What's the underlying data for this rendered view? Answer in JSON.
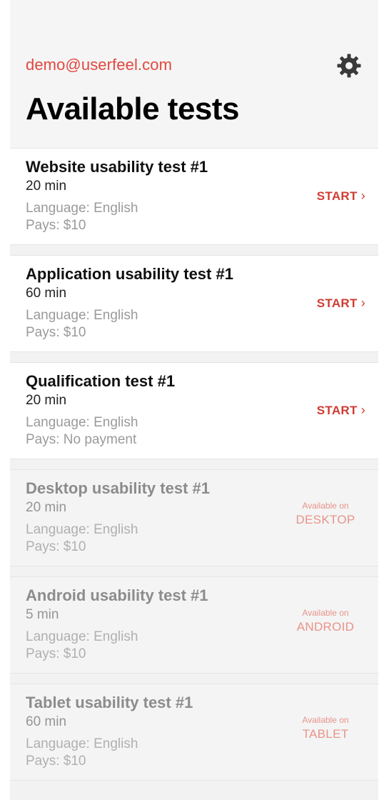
{
  "header": {
    "account_email": "demo@userfeel.com",
    "settings_icon": "gear-icon",
    "title": "Available tests"
  },
  "colors": {
    "accent": "#cf3c33",
    "email": "#e2473e",
    "muted_accent": "#e8938a",
    "background": "#f2f2f2"
  },
  "tests": [
    {
      "title": "Website usability test #1",
      "duration": "20 min",
      "language": "Language: English",
      "pays": "Pays: $10",
      "action": "START",
      "action_icon": "chevron-right-icon"
    },
    {
      "title": "Application usability test #1",
      "duration": "60 min",
      "language": "Language: English",
      "pays": "Pays: $10",
      "action": "START",
      "action_icon": "chevron-right-icon"
    },
    {
      "title": "Qualification test #1",
      "duration": "20 min",
      "language": "Language: English",
      "pays": "Pays: No payment",
      "action": "START",
      "action_icon": "chevron-right-icon"
    },
    {
      "title": "Desktop usability test #1",
      "duration": "20 min",
      "language": "Language: English",
      "pays": "Pays: $10",
      "available_caption": "Available on",
      "available_platform": "DESKTOP"
    },
    {
      "title": "Android usability test #1",
      "duration": "5 min",
      "language": "Language: English",
      "pays": "Pays: $10",
      "available_caption": "Available on",
      "available_platform": "ANDROID"
    },
    {
      "title": "Tablet usability test #1",
      "duration": "60 min",
      "language": "Language: English",
      "pays": "Pays: $10",
      "available_caption": "Available on",
      "available_platform": "TABLET"
    }
  ]
}
